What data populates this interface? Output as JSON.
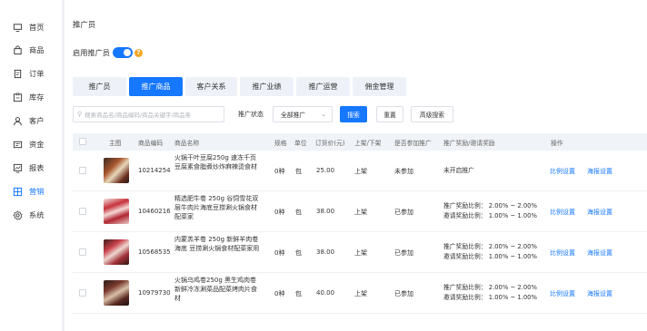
{
  "sidebar": {
    "items": [
      {
        "label": "首页",
        "icon": "monitor-icon",
        "active": false
      },
      {
        "label": "商品",
        "icon": "bag-icon",
        "active": false
      },
      {
        "label": "订单",
        "icon": "order-icon",
        "active": false
      },
      {
        "label": "库存",
        "icon": "inventory-icon",
        "active": false
      },
      {
        "label": "客户",
        "icon": "user-icon",
        "active": false
      },
      {
        "label": "资金",
        "icon": "wallet-icon",
        "active": false
      },
      {
        "label": "报表",
        "icon": "report-icon",
        "active": false
      },
      {
        "label": "营销",
        "icon": "grid-icon",
        "active": true
      },
      {
        "label": "系统",
        "icon": "gear-icon",
        "active": false
      }
    ],
    "accent": "#1677ff"
  },
  "page": {
    "title": "推广员",
    "enable_label": "启用推广员",
    "enabled": true
  },
  "tabs": [
    {
      "label": "推广员",
      "active": false
    },
    {
      "label": "推广商品",
      "active": true
    },
    {
      "label": "客户关系",
      "active": false
    },
    {
      "label": "推广业绩",
      "active": false
    },
    {
      "label": "推广运营",
      "active": false
    },
    {
      "label": "佣金管理",
      "active": false
    }
  ],
  "search": {
    "placeholder": "搜索商品名/商品编码/商品关键字/商品条",
    "status_label": "推广状态",
    "status_value": "全部推广",
    "search_button": "搜索",
    "reset_button": "重置",
    "advanced_button": "高级搜索"
  },
  "table": {
    "headers": {
      "image": "主图",
      "code": "商品编码",
      "name": "商品名称",
      "spec": "规格",
      "unit": "单位",
      "price": "订货价(元)",
      "shelf": "上架/下架",
      "joined": "是否参加推广",
      "reward": "推广奖励/邀请奖励",
      "actions": "操作"
    },
    "rows": [
      {
        "code": "10214254",
        "name": "火锅干叶豆腐250g 速冻千页豆腐素食脂煮炒炸麻辣烫食材",
        "spec": "0种",
        "unit": "包",
        "price": "25.00",
        "shelf": "上架",
        "joined": "未参加",
        "reward_line1": "未开启推广",
        "reward_line2": "",
        "action1": "比例设置",
        "action2": "海报设置"
      },
      {
        "code": "10460216",
        "name": "精选肥牛卷 250g 谷饲雪花双层牛肉片海底豆捞涮火锅食材配菜家",
        "spec": "0种",
        "unit": "包",
        "price": "38.00",
        "shelf": "上架",
        "joined": "已参加",
        "reward_line1": "推广奖励比例： 2.00% ~ 2.00%",
        "reward_line2": "邀请奖励比例： 1.00% ~ 1.00%",
        "action1": "比例设置",
        "action2": "海报设置"
      },
      {
        "code": "10568535",
        "name": "内蒙羔羊卷 250g 新鲜羊肉卷海底 豆捞涮火锅食材配菜家用",
        "spec": "0种",
        "unit": "包",
        "price": "38.00",
        "shelf": "上架",
        "joined": "已参加",
        "reward_line1": "推广奖励比例： 2.00% ~ 2.00%",
        "reward_line2": "邀请奖励比例： 1.00% ~ 1.00%",
        "action1": "比例设置",
        "action2": "海报设置"
      },
      {
        "code": "10979730",
        "name": "火锅乌鸡卷250g 黑生鸡肉卷新鲜冷冻涮菜品配菜烤肉片食材",
        "spec": "0种",
        "unit": "包",
        "price": "40.00",
        "shelf": "上架",
        "joined": "已参加",
        "reward_line1": "推广奖励比例： 2.00% ~ 2.00%",
        "reward_line2": "邀请奖励比例： 1.00% ~ 1.00%",
        "action1": "比例设置",
        "action2": "海报设置"
      }
    ]
  }
}
